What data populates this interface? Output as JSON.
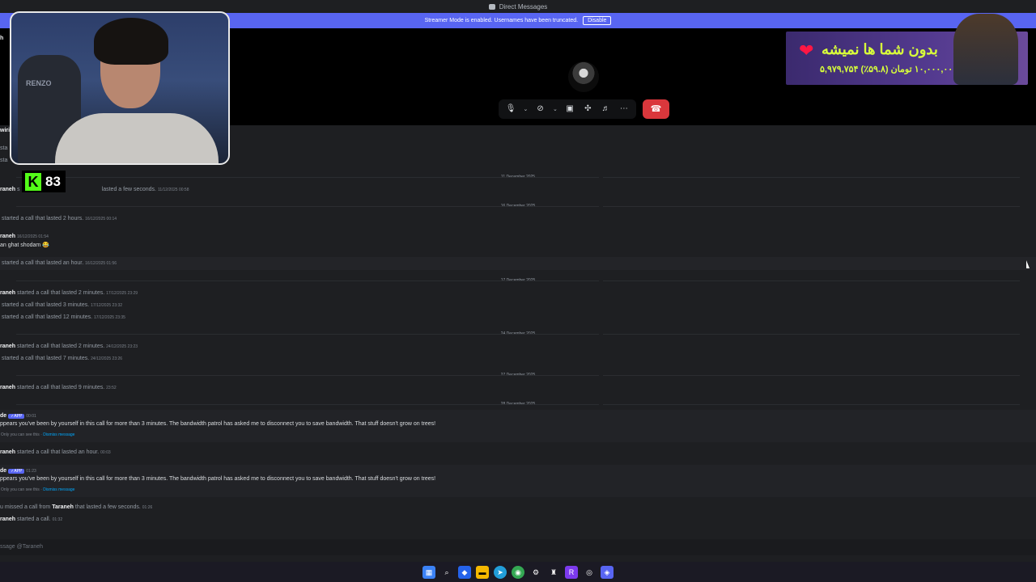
{
  "window": {
    "title": "Direct Messages"
  },
  "streamer_bar": {
    "text": "Streamer Mode is enabled. Usernames have been truncated.",
    "disable_label": "Disable"
  },
  "call": {
    "controls": [
      "mic-icon",
      "chevron-down-icon",
      "camera-off-icon",
      "chevron-down-icon",
      "screen-share-icon",
      "activities-icon",
      "soundboard-icon",
      "more-icon"
    ],
    "hangup_icon": "phone-hangup-icon"
  },
  "overlay": {
    "webcam_label": "RENZO",
    "kick_logo": "K",
    "kick_count": "83",
    "ad_line1": "بدون شما ها نمیشه",
    "ad_line2": "۵,۹۷۹,۷۵۴ از ۱۰,۰۰۰,۰۰۰ تومان (۵۹.۸٪)"
  },
  "chat": {
    "fragments": [
      {
        "text": "h"
      },
      {
        "text": "wiri"
      },
      {
        "text": "sta"
      },
      {
        "text": "sta"
      }
    ],
    "entries": [
      {
        "date": "11 December 2025"
      },
      {
        "name": "raneh",
        "text": "s",
        "rest": "lasted a few seconds.",
        "meta": "11/12/2025 00:58"
      },
      {
        "date": "16 December 2025"
      },
      {
        "text": "started a call that lasted 2 hours.",
        "meta": "16/12/2025 00:14"
      },
      {
        "name": "raneh",
        "meta": "16/12/2025 01:54",
        "message": "an ghat shodam 😂"
      },
      {
        "text": "started a call that lasted an hour.",
        "meta": "16/12/2025 01:56"
      },
      {
        "date": "17 December 2025"
      },
      {
        "name": "raneh",
        "text": "started a call that lasted 2 minutes.",
        "meta": "17/12/2025 23:29"
      },
      {
        "text": "started a call that lasted 3 minutes.",
        "meta": "17/12/2025 23:32"
      },
      {
        "text": "started a call that lasted 12 minutes.",
        "meta": "17/12/2025 23:35"
      },
      {
        "date": "24 December 2025"
      },
      {
        "name": "raneh",
        "text": "started a call that lasted 2 minutes.",
        "meta": "24/12/2025 23:23"
      },
      {
        "text": "started a call that lasted 7 minutes.",
        "meta": "24/12/2025 23:26"
      },
      {
        "date": "27 December 2025"
      },
      {
        "name": "raneh",
        "text": "started a call that lasted 9 minutes.",
        "meta": "23:52"
      },
      {
        "date": "28 December 2025"
      },
      {
        "name": "de",
        "badge": "✓APP",
        "meta": "00:01",
        "message": "ppears you've been by yourself in this call for more than 3 minutes. The bandwidth patrol has asked me to disconnect you to save bandwidth. That stuff doesn't grow on trees!",
        "note": "Only you can see this ·",
        "link": "Dismiss message"
      },
      {
        "name": "raneh",
        "text": "started a call that lasted an hour.",
        "meta": "00:03"
      },
      {
        "name": "de",
        "badge": "✓APP",
        "meta": "01:23",
        "message": "ppears you've been by yourself in this call for more than 3 minutes. The bandwidth patrol has asked me to disconnect you to save bandwidth. That stuff doesn't grow on trees!",
        "note": "Only you can see this ·",
        "link": "Dismiss message"
      },
      {
        "text": "u missed a call from",
        "name_inline": "Taraneh",
        "rest": "that lasted a few seconds.",
        "meta": "01:26"
      },
      {
        "name": "raneh",
        "text": "started a call.",
        "meta": "01:32"
      }
    ]
  },
  "composer": {
    "placeholder": "ssage @Taraneh"
  },
  "taskbar": {
    "icons": [
      "windows-start-icon",
      "search-icon",
      "vscode-icon",
      "file-explorer-icon",
      "telegram-icon",
      "chrome-icon",
      "settings-icon",
      "chess-icon",
      "r-app-icon",
      "browser-icon",
      "discord-icon"
    ]
  }
}
